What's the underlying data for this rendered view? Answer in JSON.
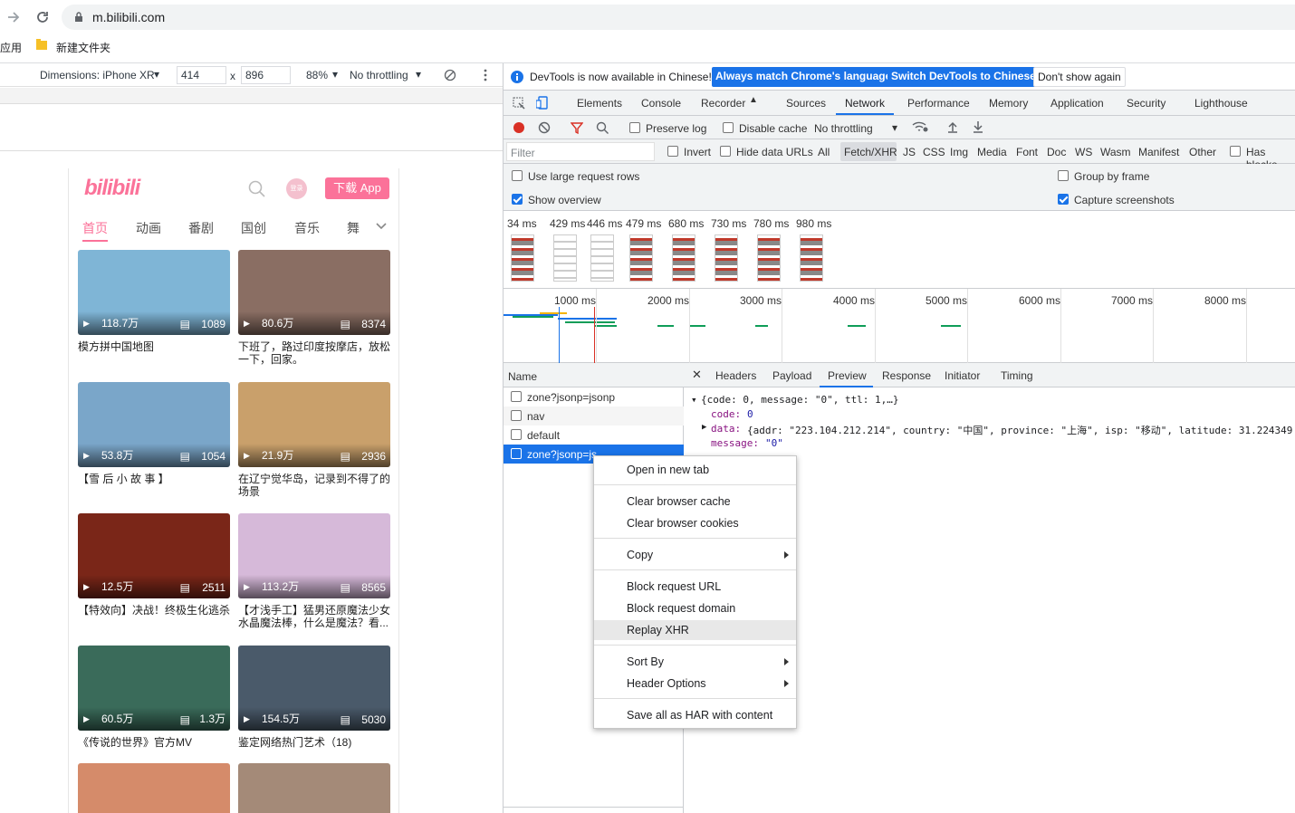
{
  "browser": {
    "url": "m.bilibili.com",
    "bookmarks": [
      "应用",
      "新建文件夹"
    ]
  },
  "device_toolbar": {
    "dimensions_label": "Dimensions: iPhone XR",
    "width": "414",
    "times": "x",
    "height": "896",
    "zoom": "88%",
    "throttling": "No throttling"
  },
  "bilibili": {
    "logo": "bilibili",
    "login": "登录",
    "download": "下载 App",
    "tabs": [
      "首页",
      "动画",
      "番剧",
      "国创",
      "音乐",
      "舞"
    ],
    "videos": [
      {
        "views": "118.7万",
        "comments": "1089",
        "title": "模方拼中国地图",
        "bg": "#7fb5d6"
      },
      {
        "views": "80.6万",
        "comments": "8374",
        "title": "下班了，路过印度按摩店，放松一下，回家。",
        "bg": "#8a6e63"
      },
      {
        "views": "53.8万",
        "comments": "1054",
        "title": "【雪 后 小 故 事 】",
        "bg": "#7aa6c9"
      },
      {
        "views": "21.9万",
        "comments": "2936",
        "title": "在辽宁觉华岛，记录到不得了的场景",
        "bg": "#c9a06b"
      },
      {
        "views": "12.5万",
        "comments": "2511",
        "title": "【特效向】决战！终极生化逃杀",
        "bg": "#7a2618"
      },
      {
        "views": "113.2万",
        "comments": "8565",
        "title": "【才浅手工】猛男还原魔法少女水晶魔法棒，什么是魔法？看...",
        "bg": "#d6b9d9"
      },
      {
        "views": "60.5万",
        "comments": "1.3万",
        "title": "《传说的世界》官方MV",
        "bg": "#3a6b5a"
      },
      {
        "views": "154.5万",
        "comments": "5030",
        "title": "鉴定网络热门艺术（18)",
        "bg": "#4a5a6a"
      },
      {
        "views": "",
        "comments": "",
        "title": "",
        "bg": "#d58b6a"
      },
      {
        "views": "",
        "comments": "",
        "title": "",
        "bg": "#a48a78"
      }
    ]
  },
  "devtools": {
    "info": "DevTools is now available in Chinese!",
    "btn_match": "Always match Chrome's language",
    "btn_switch": "Switch DevTools to Chinese",
    "btn_dont": "Don't show again",
    "tabs": [
      "Elements",
      "Console",
      "Recorder",
      "Sources",
      "Network",
      "Performance",
      "Memory",
      "Application",
      "Security",
      "Lighthouse"
    ],
    "preserve_log": "Preserve log",
    "disable_cache": "Disable cache",
    "throttling": "No throttling",
    "filter_placeholder": "Filter",
    "invert": "Invert",
    "hide_data_urls": "Hide data URLs",
    "filter_types": [
      "All",
      "Fetch/XHR",
      "JS",
      "CSS",
      "Img",
      "Media",
      "Font",
      "Doc",
      "WS",
      "Wasm",
      "Manifest",
      "Other"
    ],
    "has_blocked": "Has blocke",
    "large_rows": "Use large request rows",
    "show_overview": "Show overview",
    "group_by_frame": "Group by frame",
    "capture_screenshots": "Capture screenshots",
    "filmstrip_times": [
      "34 ms",
      "429 ms",
      "446 ms",
      "479 ms",
      "680 ms",
      "730 ms",
      "780 ms",
      "980 ms"
    ],
    "overview_ticks": [
      "1000 ms",
      "2000 ms",
      "3000 ms",
      "4000 ms",
      "5000 ms",
      "6000 ms",
      "7000 ms",
      "8000 ms"
    ],
    "name_header": "Name",
    "requests": [
      "zone?jsonp=jsonp",
      "nav",
      "default",
      "zone?jsonp=js"
    ],
    "detail_tabs": [
      "Headers",
      "Payload",
      "Preview",
      "Response",
      "Initiator",
      "Timing"
    ],
    "preview": {
      "line1": "{code: 0, message: \"0\", ttl: 1,…}",
      "code": "0",
      "data": "{addr: \"223.104.212.214\", country: \"中国\", province: \"上海\", isp: \"移动\", latitude: 31.224349",
      "message": "\"0\""
    }
  },
  "context_menu": {
    "items": [
      "Open in new tab",
      "Clear browser cache",
      "Clear browser cookies",
      "Copy",
      "Block request URL",
      "Block request domain",
      "Replay XHR",
      "Sort By",
      "Header Options",
      "Save all as HAR with content"
    ]
  }
}
